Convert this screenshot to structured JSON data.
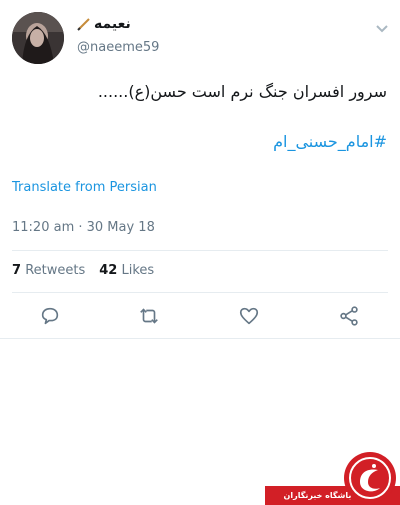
{
  "user": {
    "display_name": "نعیمه",
    "handle": "@naeeme59"
  },
  "tweet": {
    "text": "سرور افسران جنگ نرم است حسن(ع)......",
    "hashtag": "#امام_حسنی_ام",
    "translate_label": "Translate from Persian",
    "timestamp": "11:20 am · 30 May 18"
  },
  "stats": {
    "retweets_count": "7",
    "retweets_label": "Retweets",
    "likes_count": "42",
    "likes_label": "Likes"
  },
  "actions": {
    "reply_icon": "reply-icon",
    "retweet_icon": "retweet-icon",
    "like_icon": "heart-icon",
    "share_icon": "share-icon"
  },
  "watermark": {
    "text": "باشگاه خبرنگاران"
  },
  "colors": {
    "link": "#1b95e0",
    "muted": "#657786",
    "watermark": "#d21f26"
  }
}
